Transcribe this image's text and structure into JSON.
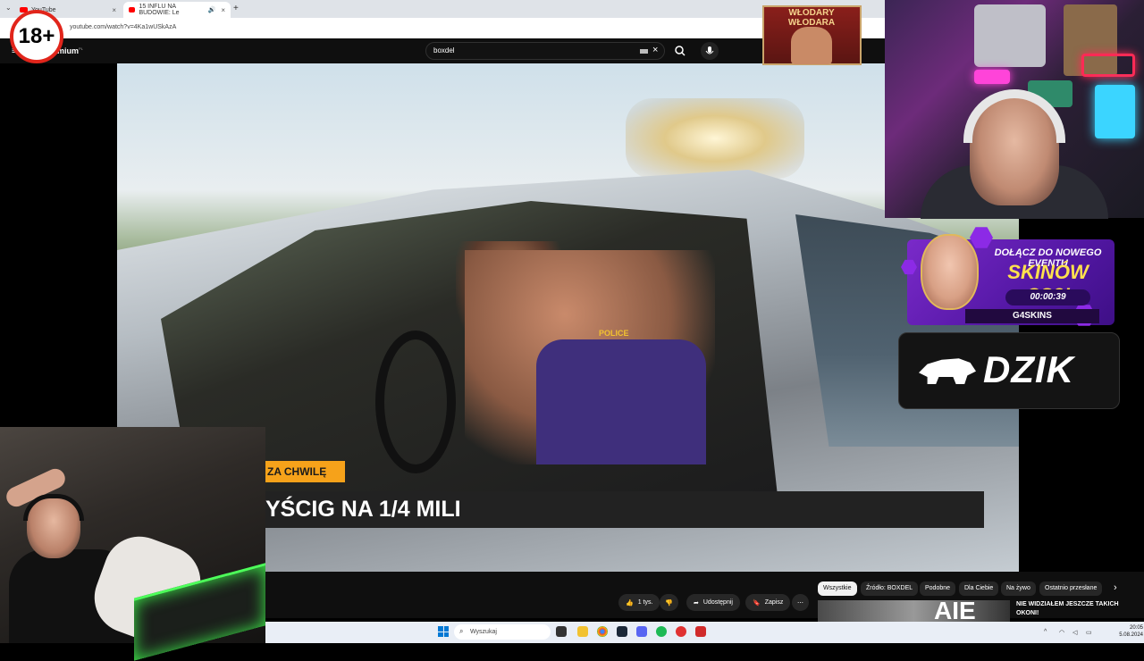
{
  "browser": {
    "tabs": [
      {
        "label": "YouTube",
        "active": false
      },
      {
        "label": "15 INFLU NA BUDOWIE: Le",
        "active": true
      }
    ],
    "url": "youtube.com/watch?v=4Ka1wUSkAzA"
  },
  "youtube": {
    "brand_suffix": "mium",
    "region": "PL",
    "search_query": "boxdel"
  },
  "overlay": {
    "age_badge": "18+",
    "logo_text": "WŁODARY WŁODARA"
  },
  "video": {
    "soon_tag": "ZA CHWILĘ",
    "banner_text": "YŚCIG NA 1/4 MILI",
    "jersey_text": "POLICE"
  },
  "ads": {
    "event_line1": "DOŁĄCZ DO NOWEGO EVENTU",
    "event_line2": "SKINÓW CS2!",
    "event_timer": "00:00:39",
    "event_brand": "G4SKINS",
    "sponsor": "DZIK"
  },
  "actions": {
    "likes": "1 tys.",
    "share": "Udostępnij",
    "save": "Zapisz"
  },
  "chips": [
    {
      "label": "Wszystkie",
      "selected": true
    },
    {
      "label": "Źródło: BOXDEL",
      "selected": false
    },
    {
      "label": "Podobne",
      "selected": false
    },
    {
      "label": "Dla Ciebie",
      "selected": false
    },
    {
      "label": "Na żywo",
      "selected": false
    },
    {
      "label": "Ostatnio przesłane",
      "selected": false
    }
  ],
  "recommended": {
    "thumb_text": "AIE",
    "title": "NIE WIDZIAŁEM JESZCZE TAKICH OKONI!"
  },
  "taskbar": {
    "search_placeholder": "Wyszukaj",
    "time": "20:05",
    "date": "5.08.2024"
  },
  "colors": {
    "yt_red": "#ff0000",
    "accent_orange": "#f6a21a",
    "event_purple": "#5317a4",
    "windows_blue": "#0078d4"
  }
}
